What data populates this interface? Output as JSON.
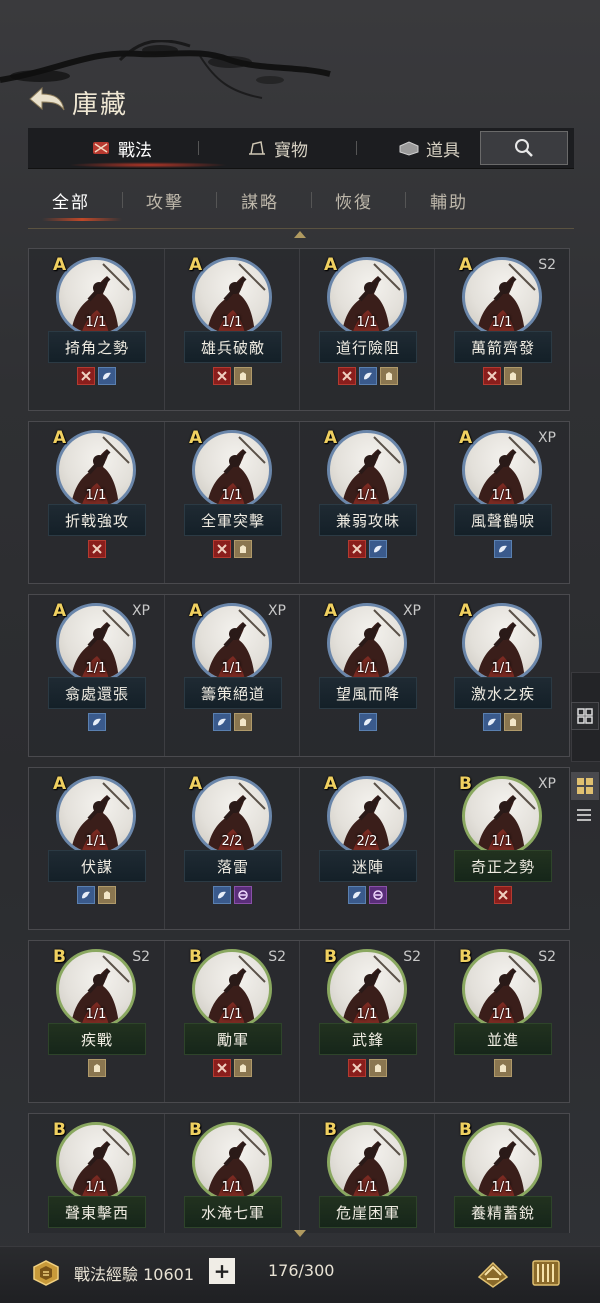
{
  "header": {
    "title": "庫藏"
  },
  "top_tabs": [
    {
      "label": "戰法",
      "icon": "scroll-icon"
    },
    {
      "label": "寶物",
      "icon": "treasure-icon"
    },
    {
      "label": "道具",
      "icon": "item-icon"
    }
  ],
  "sub_tabs": [
    "全部",
    "攻擊",
    "謀略",
    "恢復",
    "輔助"
  ],
  "rows": [
    [
      {
        "grade": "A",
        "tag": "",
        "level": "1/1",
        "name": "掎角之勢",
        "types": [
          "attack",
          "strategy"
        ]
      },
      {
        "grade": "A",
        "tag": "",
        "level": "1/1",
        "name": "雄兵破敵",
        "types": [
          "attack",
          "support"
        ]
      },
      {
        "grade": "A",
        "tag": "",
        "level": "1/1",
        "name": "道行險阻",
        "types": [
          "attack",
          "strategy",
          "support"
        ]
      },
      {
        "grade": "A",
        "tag": "S2",
        "level": "1/1",
        "name": "萬箭齊發",
        "types": [
          "attack",
          "support"
        ]
      }
    ],
    [
      {
        "grade": "A",
        "tag": "",
        "level": "1/1",
        "name": "折戟強攻",
        "types": [
          "attack"
        ]
      },
      {
        "grade": "A",
        "tag": "",
        "level": "1/1",
        "name": "全軍突擊",
        "types": [
          "attack",
          "support"
        ]
      },
      {
        "grade": "A",
        "tag": "",
        "level": "1/1",
        "name": "兼弱攻昧",
        "types": [
          "attack",
          "strategy"
        ]
      },
      {
        "grade": "A",
        "tag": "XP",
        "level": "1/1",
        "name": "風聲鶴唳",
        "types": [
          "strategy"
        ]
      }
    ],
    [
      {
        "grade": "A",
        "tag": "XP",
        "level": "1/1",
        "name": "翕處還張",
        "types": [
          "strategy"
        ]
      },
      {
        "grade": "A",
        "tag": "XP",
        "level": "1/1",
        "name": "籌策絕道",
        "types": [
          "strategy",
          "support"
        ]
      },
      {
        "grade": "A",
        "tag": "XP",
        "level": "1/1",
        "name": "望風而降",
        "types": [
          "strategy"
        ]
      },
      {
        "grade": "A",
        "tag": "",
        "level": "1/1",
        "name": "激水之疾",
        "types": [
          "strategy",
          "support"
        ]
      }
    ],
    [
      {
        "grade": "A",
        "tag": "",
        "level": "1/1",
        "name": "伏謀",
        "types": [
          "strategy",
          "support"
        ]
      },
      {
        "grade": "A",
        "tag": "",
        "level": "2/2",
        "name": "落雷",
        "types": [
          "strategy",
          "control"
        ]
      },
      {
        "grade": "A",
        "tag": "",
        "level": "2/2",
        "name": "迷陣",
        "types": [
          "strategy",
          "control"
        ]
      },
      {
        "grade": "B",
        "tag": "XP",
        "level": "1/1",
        "name": "奇正之勢",
        "types": [
          "attack"
        ]
      }
    ],
    [
      {
        "grade": "B",
        "tag": "S2",
        "level": "1/1",
        "name": "疾戰",
        "types": [
          "support"
        ]
      },
      {
        "grade": "B",
        "tag": "S2",
        "level": "1/1",
        "name": "勵軍",
        "types": [
          "attack",
          "support"
        ]
      },
      {
        "grade": "B",
        "tag": "S2",
        "level": "1/1",
        "name": "武鋒",
        "types": [
          "attack",
          "support"
        ]
      },
      {
        "grade": "B",
        "tag": "S2",
        "level": "1/1",
        "name": "並進",
        "types": [
          "support"
        ]
      }
    ],
    [
      {
        "grade": "B",
        "tag": "",
        "level": "1/1",
        "name": "聲東擊西",
        "types": []
      },
      {
        "grade": "B",
        "tag": "",
        "level": "1/1",
        "name": "水淹七軍",
        "types": []
      },
      {
        "grade": "B",
        "tag": "",
        "level": "1/1",
        "name": "危崖困軍",
        "types": []
      },
      {
        "grade": "B",
        "tag": "",
        "level": "1/1",
        "name": "養精蓄銳",
        "types": []
      }
    ]
  ],
  "bottom": {
    "exp_label": "戰法經驗",
    "exp_value": "10601",
    "plus": "+",
    "count": "176/300"
  },
  "colors": {
    "grade_a_ring": "#6a86aa",
    "grade_b_ring": "#8aa860",
    "grade_text": "#f0d060",
    "attack": "#8a1e1c",
    "strategy": "#3a5a8c",
    "support": "#8a7650",
    "control": "#5a2e7a"
  }
}
